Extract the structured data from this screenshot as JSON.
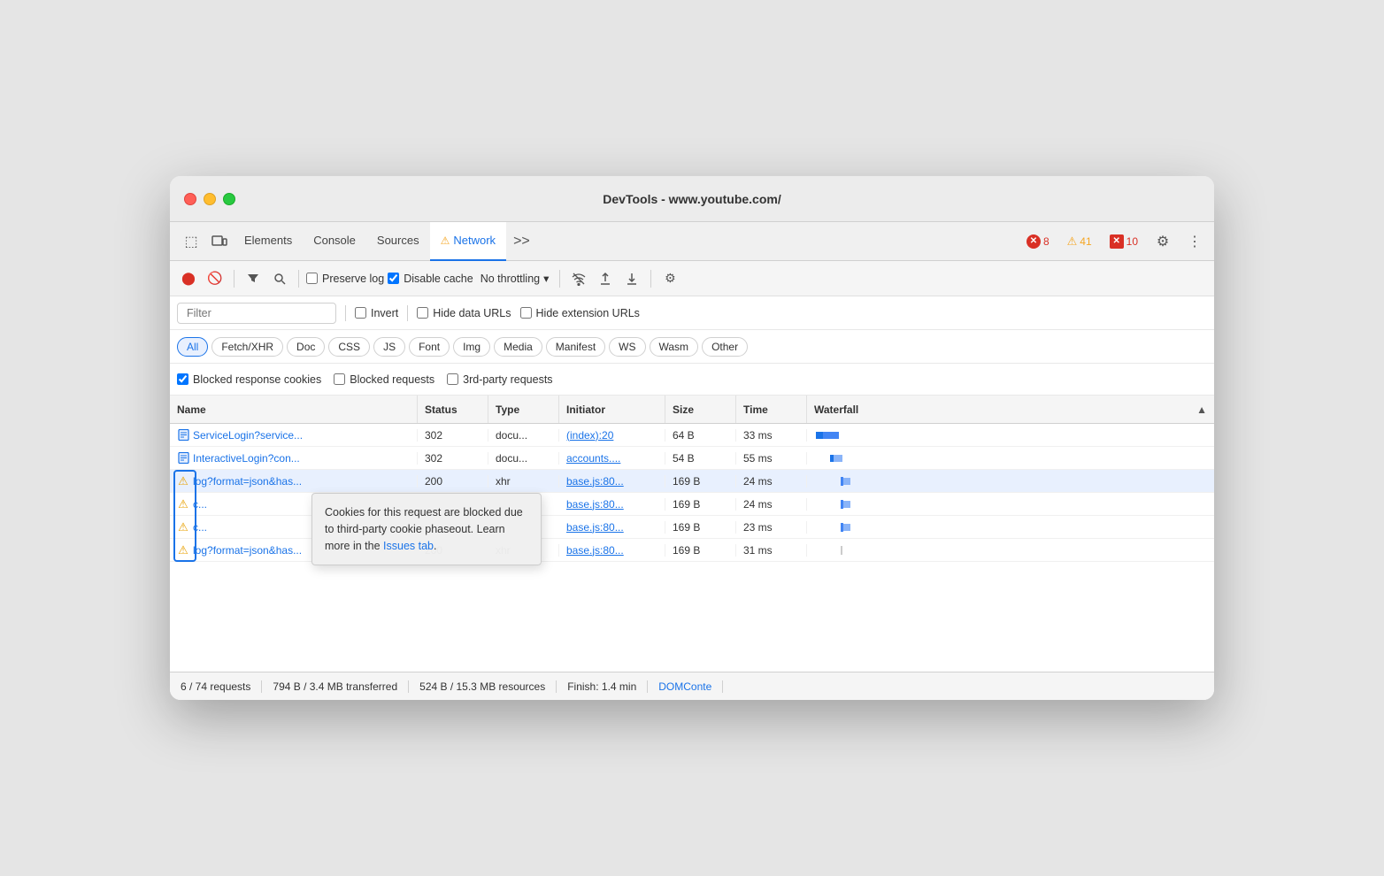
{
  "window": {
    "title": "DevTools - www.youtube.com/"
  },
  "tabs": {
    "items": [
      {
        "label": "Elements",
        "active": false
      },
      {
        "label": "Console",
        "active": false
      },
      {
        "label": "Sources",
        "active": false
      },
      {
        "label": "Network",
        "active": true,
        "hasWarning": true
      },
      {
        "label": "More tabs",
        "icon": ">>"
      }
    ],
    "error_counts": {
      "red_x": "8",
      "yellow_warn": "41",
      "dark_red": "10"
    }
  },
  "toolbar": {
    "preserve_log_label": "Preserve log",
    "disable_cache_label": "Disable cache",
    "throttle_label": "No throttling"
  },
  "filter": {
    "placeholder": "Filter",
    "invert_label": "Invert",
    "hide_data_urls_label": "Hide data URLs",
    "hide_extension_urls_label": "Hide extension URLs"
  },
  "resource_types": [
    {
      "label": "All",
      "active": true
    },
    {
      "label": "Fetch/XHR",
      "active": false
    },
    {
      "label": "Doc",
      "active": false
    },
    {
      "label": "CSS",
      "active": false
    },
    {
      "label": "JS",
      "active": false
    },
    {
      "label": "Font",
      "active": false
    },
    {
      "label": "Img",
      "active": false
    },
    {
      "label": "Media",
      "active": false
    },
    {
      "label": "Manifest",
      "active": false
    },
    {
      "label": "WS",
      "active": false
    },
    {
      "label": "Wasm",
      "active": false
    },
    {
      "label": "Other",
      "active": false
    }
  ],
  "blocked": {
    "blocked_response_cookies_label": "Blocked response cookies",
    "blocked_requests_label": "Blocked requests",
    "third_party_requests_label": "3rd-party requests"
  },
  "table": {
    "headers": [
      "Name",
      "Status",
      "Type",
      "Initiator",
      "Size",
      "Time",
      "Waterfall"
    ],
    "rows": [
      {
        "icon": "doc",
        "name": "ServiceLogin?service...",
        "status": "302",
        "type": "docu...",
        "initiator": "(index):20",
        "initiator_link": true,
        "size": "64 B",
        "time": "33 ms"
      },
      {
        "icon": "doc",
        "name": "InteractiveLogin?con...",
        "status": "302",
        "type": "docu...",
        "initiator": "accounts....",
        "initiator_link": true,
        "size": "54 B",
        "time": "55 ms"
      },
      {
        "icon": "warning",
        "name": "log?format=json&has...",
        "status": "200",
        "type": "xhr",
        "initiator": "base.js:80...",
        "initiator_link": true,
        "size": "169 B",
        "time": "24 ms"
      },
      {
        "icon": "warning",
        "name": "c...",
        "status": "",
        "type": "",
        "initiator": "base.js:80...",
        "initiator_link": true,
        "size": "169 B",
        "time": "24 ms"
      },
      {
        "icon": "warning",
        "name": "c...",
        "status": "",
        "type": "",
        "initiator": "base.js:80...",
        "initiator_link": true,
        "size": "169 B",
        "time": "23 ms"
      },
      {
        "icon": "warning",
        "name": "log?format=json&has...",
        "status": "200",
        "type": "xhr",
        "initiator": "base.js:80...",
        "initiator_link": true,
        "size": "169 B",
        "time": "31 ms"
      }
    ]
  },
  "tooltip": {
    "text": "Cookies for this request are blocked due to third-party cookie phaseout. Learn more in the Issues tab.",
    "link_text": "Issues tab"
  },
  "status_bar": {
    "requests": "6 / 74 requests",
    "transferred": "794 B / 3.4 MB transferred",
    "resources": "524 B / 15.3 MB resources",
    "finish": "Finish: 1.4 min",
    "dom": "DOMConte"
  }
}
